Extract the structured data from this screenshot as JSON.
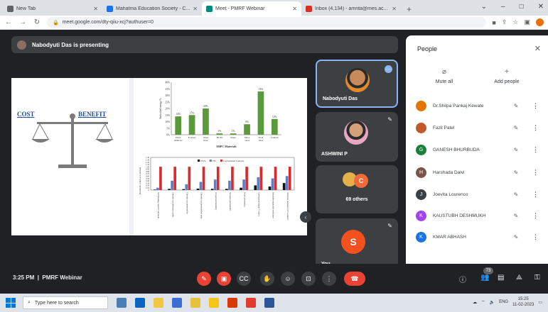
{
  "browser": {
    "tabs": [
      {
        "title": "New Tab",
        "color": "#5f6368",
        "active": false
      },
      {
        "title": "Mahatma Education Society - C...",
        "color": "#1a73e8",
        "active": false
      },
      {
        "title": "Meet - PMRF Webinar",
        "color": "#00897b",
        "active": true
      },
      {
        "title": "Inbox (4,134) - amrita@mes.ac...",
        "color": "#d93025",
        "active": false
      }
    ],
    "url": "meet.google.com/dty-qiiu-xcj?authuser=0"
  },
  "meeting": {
    "presenter_banner": "Nabodyuti Das is presenting",
    "time": "3:25 PM",
    "separator": "|",
    "title": "PMRF Webinar",
    "participant_count": "73"
  },
  "slide": {
    "cost_label": "COST",
    "benefit_label": "BENEFIT"
  },
  "chart_data": [
    {
      "type": "bar",
      "title": "",
      "xlabel": "EBPC Materials",
      "ylabel": "Embodied energy %",
      "categories": [
        "Water infiltrate",
        "E-Glass",
        "Glass fiber",
        "HCM",
        "Water",
        "Silica sand",
        "Steel fibre",
        "Cement"
      ],
      "values": [
        14,
        15,
        20,
        1,
        1,
        8,
        33,
        12
      ],
      "data_labels": [
        "14%",
        "15%",
        "20%",
        "1%",
        "1%",
        "8%",
        "33%",
        "12%"
      ],
      "ylim": [
        0,
        40
      ],
      "yticks": [
        "0%",
        "5%",
        "10%",
        "15%",
        "20%",
        "25%",
        "30%",
        "35%",
        "40%"
      ],
      "colors": [
        "#5a9a3a"
      ]
    },
    {
      "type": "bar",
      "title": "",
      "ylabel": "Parameter relative to normal",
      "categories": [
        "Self-healing capacity (28 months)",
        "Chloride ion diffusion coefficient",
        "Chloride ion permeability",
        "Chloride ion permeability under freeze-thaw",
        "Oxygen permeability",
        "Nitrogen permeability",
        "Water absorption",
        "Carbonation depth (7 years)",
        "Bondable/repairable resistance",
        "Abrasion resistance (6% cement ratio)"
      ],
      "ylim": [
        0,
        1.4
      ],
      "yticks": [
        "0",
        "0.10",
        "0.20",
        "0.30",
        "0.40",
        "0.50",
        "0.60",
        "0.70",
        "0.80",
        "0.90",
        "1.00",
        "1.10",
        "1.20",
        "1.30",
        "1.40"
      ],
      "series": [
        {
          "name": "ECPC",
          "color": "#111111",
          "values": [
            0.02,
            0.05,
            0.04,
            0.06,
            0.05,
            0.05,
            0.1,
            0.2,
            0.15,
            0.3
          ]
        },
        {
          "name": "SFC",
          "color": "#5b7fc7",
          "values": [
            0.1,
            0.4,
            0.25,
            0.35,
            0.45,
            0.4,
            0.45,
            0.55,
            0.5,
            0.6
          ]
        },
        {
          "name": "Conventional Concrete",
          "color": "#d92b2b",
          "values": [
            1.0,
            1.0,
            1.0,
            1.0,
            1.0,
            1.0,
            1.0,
            1.0,
            1.0,
            1.0
          ]
        }
      ]
    }
  ],
  "tiles": [
    {
      "name": "Nabodyuti Das"
    },
    {
      "name": "ASHWINI P"
    },
    {
      "name": "69 others",
      "avatar_letter": "C"
    },
    {
      "name": "You",
      "avatar_letter": "S"
    }
  ],
  "people_panel": {
    "title": "People",
    "mute_all_label": "Mute all",
    "add_people_label": "Add people",
    "participants": [
      {
        "name": "Dr.Shilpa Pankaj Kewate",
        "initial": "",
        "color": "#e37400"
      },
      {
        "name": "Fazil Patel",
        "initial": "",
        "color": "#c05a2c"
      },
      {
        "name": "GANESH BHURBUDA",
        "initial": "G",
        "color": "#188038"
      },
      {
        "name": "Harshada Dalvi",
        "initial": "H",
        "color": "#795548"
      },
      {
        "name": "Joevita Lourenco",
        "initial": "J",
        "color": "#3c4043"
      },
      {
        "name": "KAUSTUBH DESHMUKH",
        "initial": "K",
        "color": "#a142f4"
      },
      {
        "name": "KMAR ABHASH",
        "initial": "K",
        "color": "#1a73e8"
      }
    ]
  },
  "taskbar": {
    "search_placeholder": "Type here to search",
    "lang": "ENG",
    "clock_time": "15:25",
    "clock_date": "11-02-2023"
  }
}
